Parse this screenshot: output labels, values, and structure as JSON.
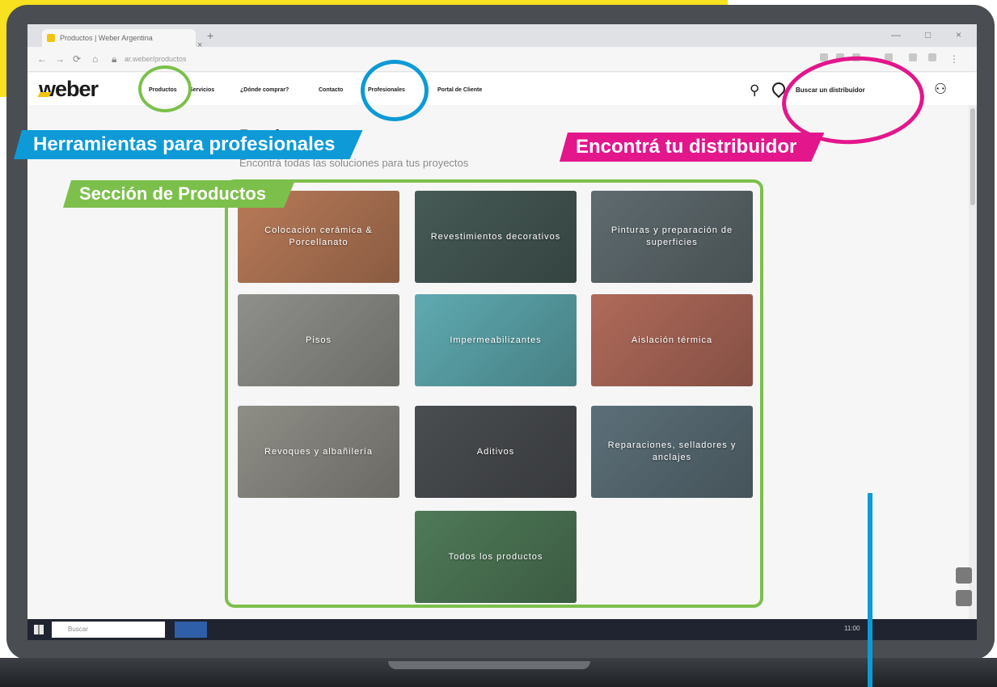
{
  "browser": {
    "tab_title": "Productos | Weber Argentina",
    "tab_close": "×",
    "new_tab": "+",
    "url": "ar.weber/productos",
    "window_controls": [
      "—",
      "□",
      "×"
    ]
  },
  "header": {
    "logo": "weber",
    "nav": [
      "Productos",
      "Servicios",
      "¿Dónde comprar?",
      "Contacto",
      "Profesionales",
      "Portal de Cliente"
    ],
    "distributor_link": "Buscar un distribuidor",
    "icons": [
      "search-icon",
      "location-pin-icon",
      "user-icon"
    ]
  },
  "page": {
    "title": "Productos",
    "subtitle": "Encontrá todas las soluciones para tus proyectos"
  },
  "tiles": [
    {
      "label": "Colocación cerámica & Porcellanato",
      "color": "#b87a58"
    },
    {
      "label": "Revestimientos decorativos",
      "color": "#465a56"
    },
    {
      "label": "Pinturas y preparación de superficies",
      "color": "#5f6b6f"
    },
    {
      "label": "Pisos",
      "color": "#8f8f8b"
    },
    {
      "label": "Impermeabilizantes",
      "color": "#5eaab0"
    },
    {
      "label": "Aislación térmica",
      "color": "#b06a5a"
    },
    {
      "label": "Revoques y albañilería",
      "color": "#8e8d86"
    },
    {
      "label": "Aditivos",
      "color": "#4a4d50"
    },
    {
      "label": "Reparaciones, selladores y anclajes",
      "color": "#5c6f78"
    },
    {
      "label": "Todos los productos",
      "color": "#4f7a58"
    }
  ],
  "annotations": {
    "products_section": "Sección de Productos",
    "professionals": "Herramientas para profesionales",
    "distributor": "Encontrá tu distribuidor"
  },
  "taskbar": {
    "search_placeholder": "Buscar",
    "clock": "11:00"
  },
  "colors": {
    "brand_yellow": "#f8e21f",
    "annotation_green": "#7cc04b",
    "annotation_blue": "#0d9ad6",
    "annotation_magenta": "#e3168c"
  }
}
